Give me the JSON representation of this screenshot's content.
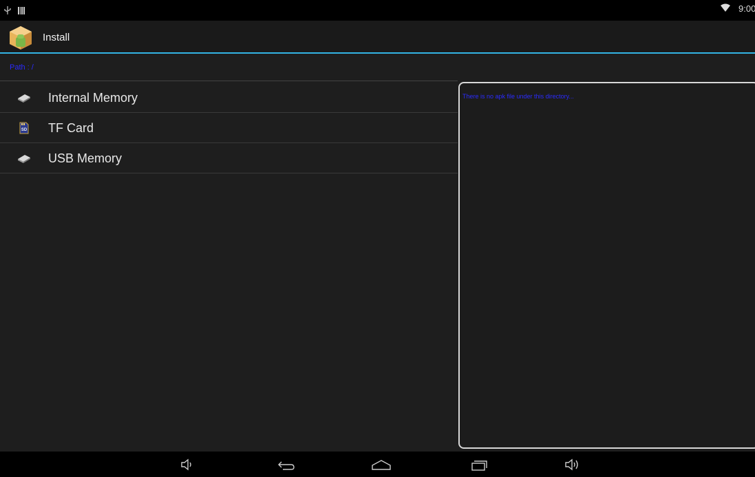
{
  "statusbar": {
    "left_icons": [
      "usb-icon",
      "barcode-icon"
    ],
    "time": "9:00",
    "wifi_icon": "wifi-icon"
  },
  "actionbar": {
    "title": "Install",
    "app_icon": "package-installer-icon",
    "accent_color": "#33b5e5"
  },
  "path": {
    "label": "Path : /",
    "color": "#2b2bff"
  },
  "storage": {
    "items": [
      {
        "label": "Internal Memory",
        "icon": "drive-icon"
      },
      {
        "label": "TF Card",
        "icon": "sd-card-icon"
      },
      {
        "label": "USB Memory",
        "icon": "drive-icon"
      }
    ]
  },
  "preview": {
    "message": "There is no apk file under this directory..."
  },
  "navbar": {
    "buttons": [
      "volume-down-icon",
      "back-icon",
      "home-icon",
      "recent-apps-icon",
      "volume-up-icon"
    ]
  }
}
